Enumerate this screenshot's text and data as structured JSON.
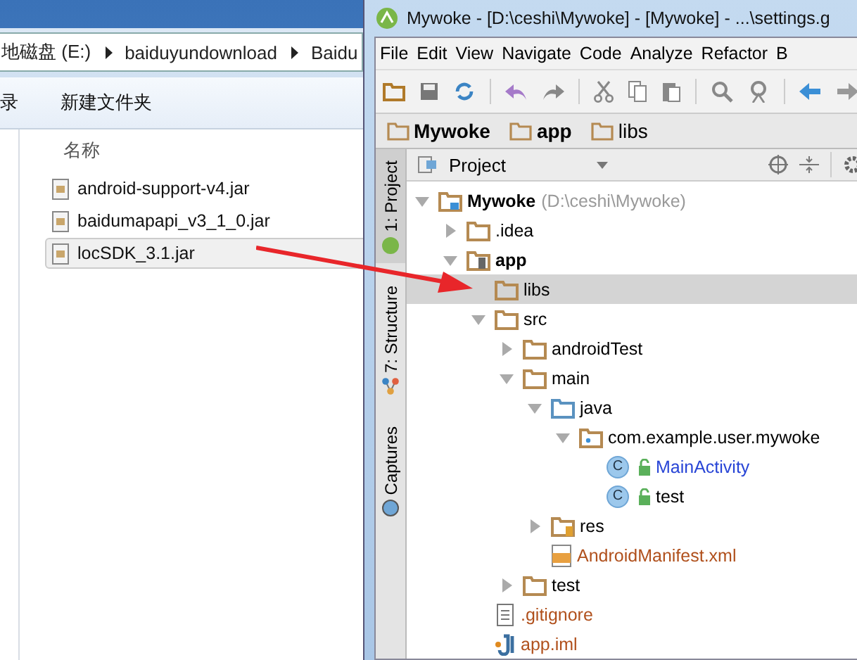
{
  "explorer": {
    "address": [
      "地磁盘 (E:)",
      "baiduyundownload",
      "Baidu"
    ],
    "toolbar": [
      "录",
      "新建文件夹"
    ],
    "column_header": "名称",
    "files": [
      {
        "name": "android-support-v4.jar",
        "selected": false
      },
      {
        "name": "baidumapapi_v3_1_0.jar",
        "selected": false
      },
      {
        "name": "locSDK_3.1.jar",
        "selected": true
      }
    ]
  },
  "ide": {
    "title": "Mywoke - [D:\\ceshi\\Mywoke] - [Mywoke] - ...\\settings.g",
    "menu": [
      "File",
      "Edit",
      "View",
      "Navigate",
      "Code",
      "Analyze",
      "Refactor",
      "B"
    ],
    "breadcrumbs": [
      {
        "label": "Mywoke",
        "bold": true
      },
      {
        "label": "app",
        "bold": true
      },
      {
        "label": "libs",
        "bold": false
      }
    ],
    "side_tabs": [
      {
        "label": "1: Project",
        "kind": "project",
        "selected": true
      },
      {
        "label": "7: Structure",
        "kind": "structure",
        "selected": false
      },
      {
        "label": "Captures",
        "kind": "captures",
        "selected": false
      }
    ],
    "panel_view": "Project",
    "tree": [
      {
        "name": "Mywoke",
        "hint": "(D:\\ceshi\\Mywoke)",
        "kind": "module",
        "bold": true,
        "color": "#000000",
        "expanded": true,
        "selected": false,
        "children": [
          {
            "name": ".idea",
            "kind": "folder",
            "bold": false,
            "color": "#000000",
            "expanded": false,
            "selected": false
          },
          {
            "name": "app",
            "kind": "android-module",
            "bold": true,
            "color": "#000000",
            "expanded": true,
            "selected": false,
            "children": [
              {
                "name": "libs",
                "kind": "folder",
                "bold": false,
                "color": "#000000",
                "selected": true
              },
              {
                "name": "src",
                "kind": "folder",
                "bold": false,
                "color": "#000000",
                "expanded": true,
                "selected": false,
                "children": [
                  {
                    "name": "androidTest",
                    "kind": "folder",
                    "bold": false,
                    "color": "#000000",
                    "expanded": false,
                    "selected": false
                  },
                  {
                    "name": "main",
                    "kind": "folder",
                    "bold": false,
                    "color": "#000000",
                    "expanded": true,
                    "selected": false,
                    "children": [
                      {
                        "name": "java",
                        "kind": "source-folder",
                        "bold": false,
                        "color": "#000000",
                        "expanded": true,
                        "selected": false,
                        "children": [
                          {
                            "name": "com.example.user.mywoke",
                            "kind": "package",
                            "bold": false,
                            "color": "#000000",
                            "expanded": true,
                            "selected": false,
                            "children": [
                              {
                                "name": "MainActivity",
                                "kind": "class",
                                "badge": "C",
                                "bold": false,
                                "color": "#2845d6",
                                "selected": false
                              },
                              {
                                "name": "test",
                                "kind": "class",
                                "badge": "C",
                                "bold": false,
                                "color": "#000000",
                                "selected": false
                              }
                            ]
                          }
                        ]
                      },
                      {
                        "name": "res",
                        "kind": "res-folder",
                        "bold": false,
                        "color": "#000000",
                        "expanded": false,
                        "selected": false
                      },
                      {
                        "name": "AndroidManifest.xml",
                        "kind": "manifest",
                        "bold": false,
                        "color": "#b0501c",
                        "selected": false
                      }
                    ]
                  },
                  {
                    "name": "test",
                    "kind": "folder",
                    "bold": false,
                    "color": "#000000",
                    "expanded": false,
                    "selected": false
                  }
                ]
              },
              {
                "name": ".gitignore",
                "kind": "text-file",
                "bold": false,
                "color": "#b0501c",
                "selected": false
              },
              {
                "name": "app.iml",
                "kind": "iml",
                "bold": false,
                "color": "#b0501c",
                "selected": false
              }
            ]
          }
        ]
      }
    ]
  }
}
